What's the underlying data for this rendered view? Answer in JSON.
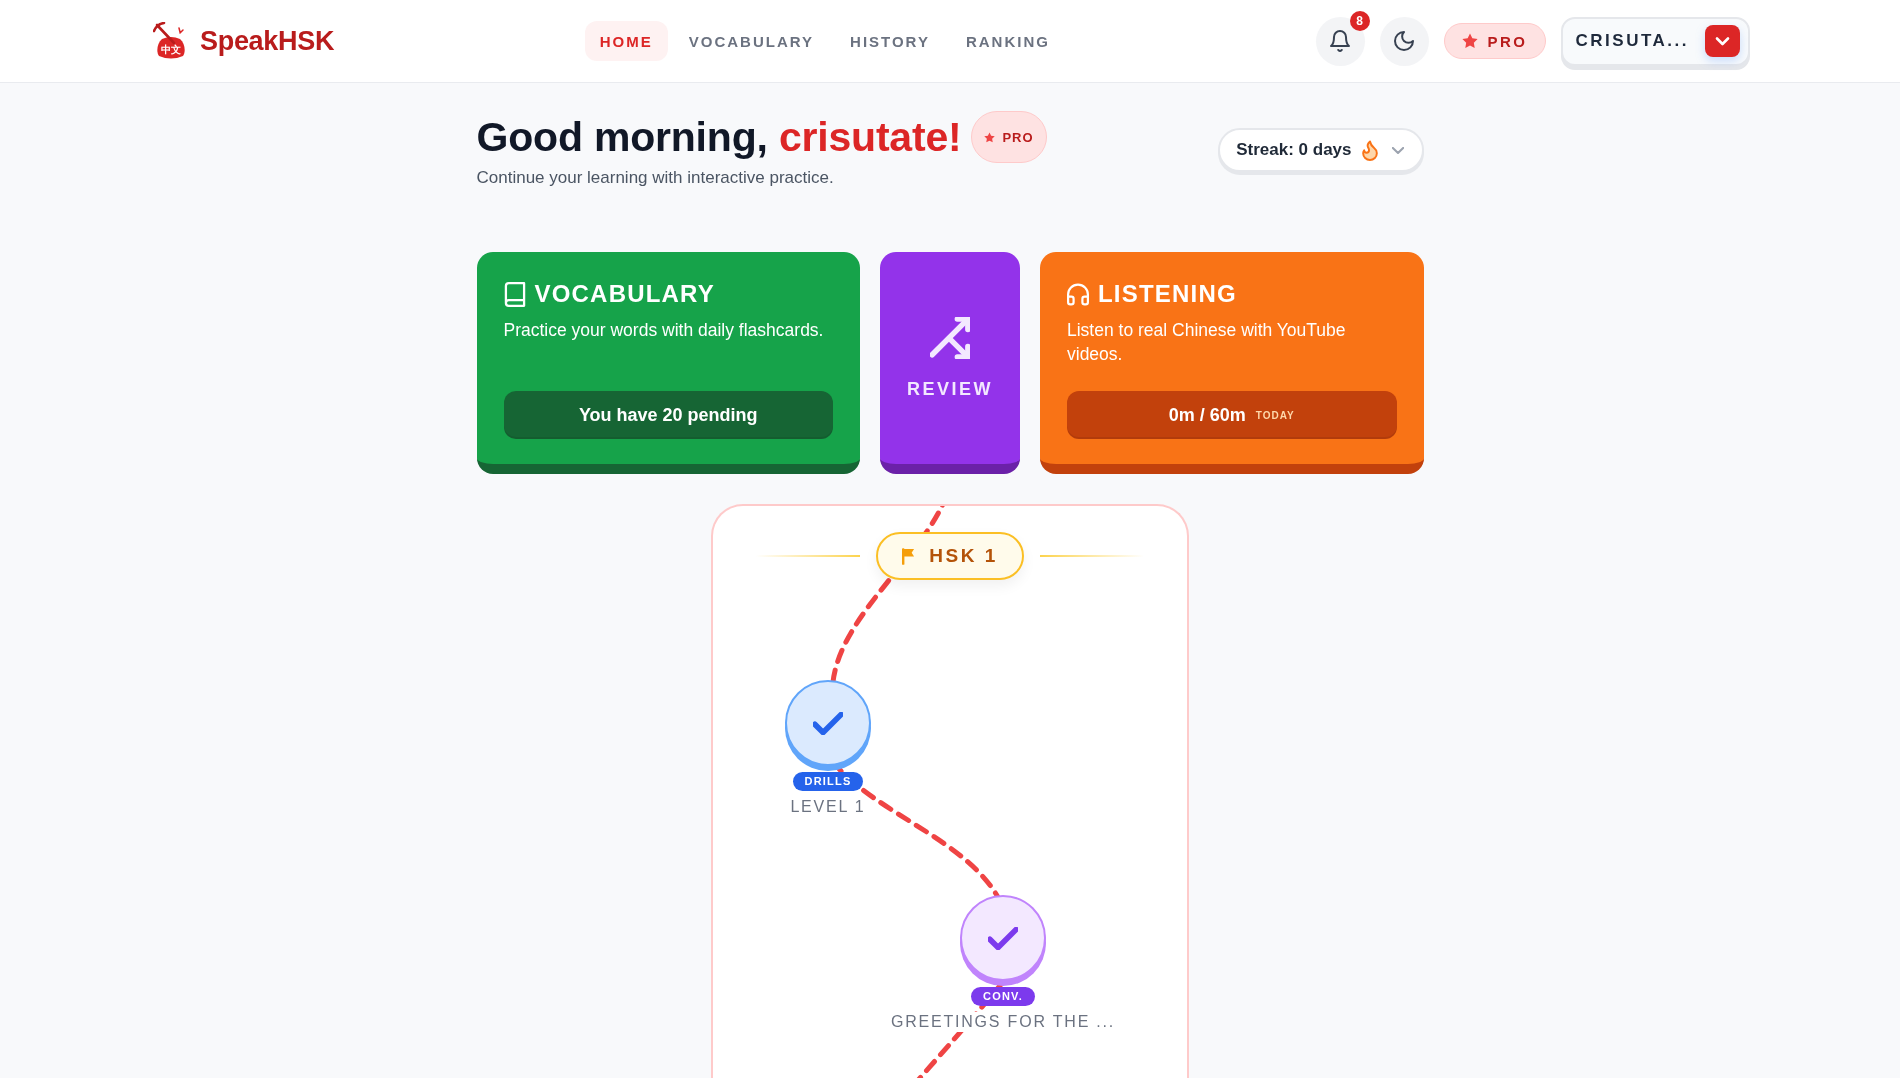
{
  "header": {
    "logo": {
      "mark_text": "中文",
      "name": "SpeakHSK"
    },
    "nav": [
      {
        "label": "HOME",
        "selected": true
      },
      {
        "label": "VOCABULARY",
        "selected": false
      },
      {
        "label": "HISTORY",
        "selected": false
      },
      {
        "label": "RANKING",
        "selected": false
      }
    ],
    "notifications": {
      "count": "8"
    },
    "upgrade": {
      "label": "PRO"
    },
    "user_menu": {
      "name": "CRISUTA..."
    }
  },
  "greeting": {
    "salutation": "Good morning,",
    "name": "crisutate!",
    "badge": "PRO",
    "subtitle": "Continue your learning with interactive practice."
  },
  "streak": {
    "label": "Streak: 0 days"
  },
  "cards": [
    {
      "kind": "vocabulary",
      "title": "VOCABULARY",
      "description": "Practice your words with daily flashcards.",
      "action": "You have 20 pending"
    },
    {
      "kind": "review",
      "title": "REVIEW"
    },
    {
      "kind": "listening",
      "title": "LISTENING",
      "description": "Listen to real Chinese with YouTube videos.",
      "action": "0m / 60m",
      "action_note": "TODAY"
    }
  ],
  "path": {
    "section": "HSK 1",
    "nodes": [
      {
        "kind": "drills",
        "tag": "DRILLS",
        "title": "LEVEL 1",
        "completed": true
      },
      {
        "kind": "conversation",
        "tag": "CONV.",
        "title": "GREETINGS FOR THE ...",
        "completed": true
      }
    ]
  }
}
